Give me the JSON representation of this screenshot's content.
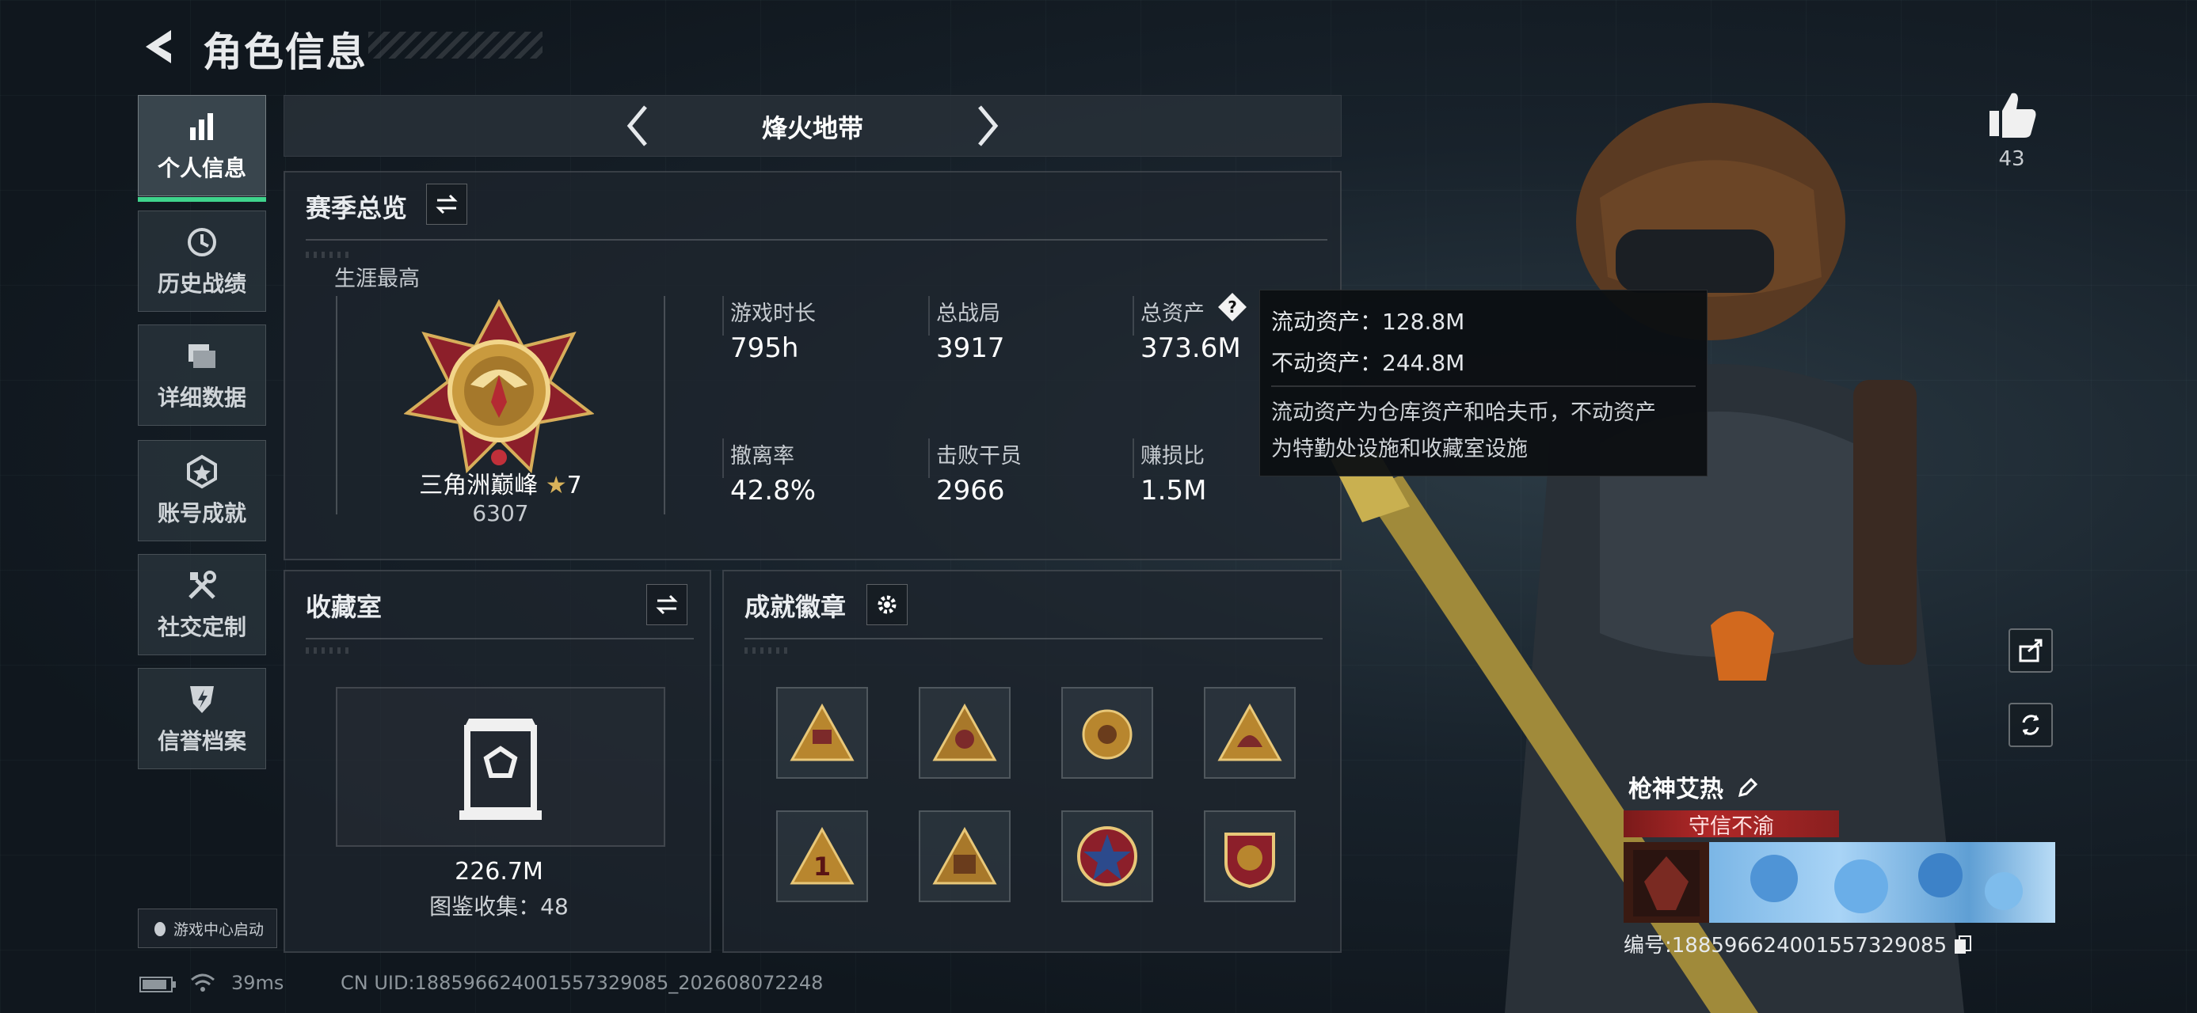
{
  "header": {
    "title": "角色信息"
  },
  "sidebar": {
    "items": [
      {
        "label": "个人信息",
        "icon": "bar-chart-icon",
        "active": true
      },
      {
        "label": "历史战绩",
        "icon": "history-icon"
      },
      {
        "label": "详细数据",
        "icon": "files-icon"
      },
      {
        "label": "账号成就",
        "icon": "achievement-icon"
      },
      {
        "label": "社交定制",
        "icon": "tools-icon"
      },
      {
        "label": "信誉档案",
        "icon": "shield-icon"
      }
    ],
    "game_center": "游戏中心启动"
  },
  "mode": {
    "title": "烽火地带"
  },
  "season": {
    "title": "赛季总览",
    "career_best": "生涯最高",
    "rank_name": "三角洲巅峰",
    "rank_stars": "7",
    "rank_score": "6307",
    "stats": [
      {
        "label": "游戏时长",
        "value": "795h"
      },
      {
        "label": "总战局",
        "value": "3917"
      },
      {
        "label": "总资产",
        "value": "373.6M"
      },
      {
        "label": "撤离率",
        "value": "42.8%"
      },
      {
        "label": "击败干员",
        "value": "2966"
      },
      {
        "label": "赚损比",
        "value": "1.5M"
      }
    ]
  },
  "tooltip": {
    "liquid": "流动资产：128.8M",
    "fixed": "不动资产：244.8M",
    "desc_line1": "流动资产为仓库资产和哈夫币，不动资产",
    "desc_line2": "为特勤处设施和收藏室设施"
  },
  "collection": {
    "title": "收藏室",
    "value": "226.7M",
    "count": "图鉴收集：48"
  },
  "badges": {
    "title": "成就徽章",
    "count": 8
  },
  "profile": {
    "likes": "43",
    "player_name": "枪神艾热",
    "honor": "守信不渝",
    "uid": "编号:188596624001557329085"
  },
  "status": {
    "ping": "39ms",
    "uid": "CN UID:188596624001557329085_202608072248"
  },
  "colors": {
    "accent": "#3fd38c",
    "honor": "#b02828",
    "tooltip_bg": "#0c0f12"
  }
}
